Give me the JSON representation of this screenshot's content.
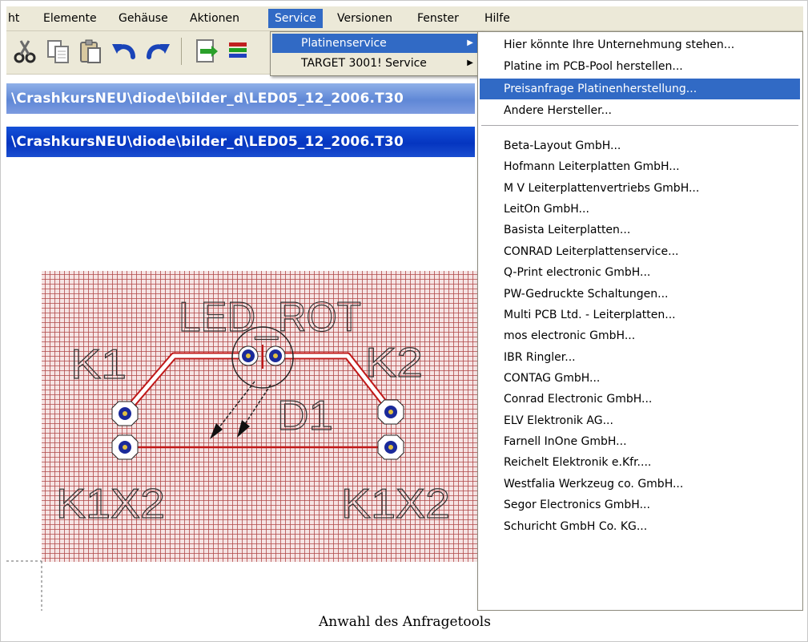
{
  "menubar": {
    "items": [
      {
        "label": "ht"
      },
      {
        "label": "Elemente"
      },
      {
        "label": "Gehäuse"
      },
      {
        "label": "Aktionen"
      },
      {
        "label": "Service"
      },
      {
        "label": "Versionen"
      },
      {
        "label": "Fenster"
      },
      {
        "label": "Hilfe"
      }
    ],
    "active_item": "Service"
  },
  "toolbar": {
    "icons": [
      "cut-icon",
      "copy-icon",
      "paste-icon",
      "undo-icon",
      "redo-icon",
      "import-icon",
      "layers-icon"
    ]
  },
  "windows": {
    "title_inactive": "\\CrashkursNEU\\diode\\bilder_d\\LED05_12_2006.T30",
    "title_active": "\\CrashkursNEU\\diode\\bilder_d\\LED05_12_2006.T30"
  },
  "pcb": {
    "label_led": "LED_ROT",
    "label_k1": "K1",
    "label_k2": "K2",
    "label_d1": "D1",
    "label_k1x2_left": "K1X2",
    "label_k1x2_right": "K1X2"
  },
  "service_menu": {
    "items": [
      {
        "label": "Platinenservice",
        "highlighted": true,
        "has_submenu": true
      },
      {
        "label": "TARGET 3001! Service",
        "highlighted": false,
        "has_submenu": true
      }
    ]
  },
  "platinenservice_menu": {
    "group1": [
      {
        "label": "Hier könnte Ihre Unternehmung stehen..."
      },
      {
        "label": "Platine im PCB-Pool herstellen..."
      },
      {
        "label": "Preisanfrage Platinenherstellung...",
        "highlighted": true
      },
      {
        "label": "Andere Hersteller..."
      }
    ],
    "group2": [
      {
        "label": "Beta-Layout GmbH..."
      },
      {
        "label": "Hofmann Leiterplatten GmbH..."
      },
      {
        "label": "M  V Leiterplattenvertriebs GmbH..."
      },
      {
        "label": "LeitOn GmbH..."
      },
      {
        "label": "Basista Leiterplatten..."
      },
      {
        "label": "CONRAD Leiterplattenservice..."
      },
      {
        "label": "Q-Print electronic GmbH..."
      },
      {
        "label": "PW-Gedruckte Schaltungen..."
      },
      {
        "label": "Multi PCB Ltd. - Leiterplatten..."
      },
      {
        "label": "mos electronic GmbH..."
      },
      {
        "label": "IBR Ringler..."
      },
      {
        "label": "CONTAG GmbH..."
      },
      {
        "label": "Conrad Electronic GmbH..."
      },
      {
        "label": "ELV Elektronik AG..."
      },
      {
        "label": "Farnell InOne GmbH..."
      },
      {
        "label": "Reichelt Elektronik e.Kfr...."
      },
      {
        "label": "Westfalia Werkzeug co. GmbH..."
      },
      {
        "label": "Segor Electronics GmbH..."
      },
      {
        "label": "Schuricht GmbH  Co. KG..."
      }
    ]
  },
  "caption": "Anwahl des Anfragetools",
  "colors": {
    "menu_highlight": "#316ac5",
    "pcb_grid": "#b04848",
    "trace": "#c01818",
    "pad": "#1a2a9a"
  }
}
